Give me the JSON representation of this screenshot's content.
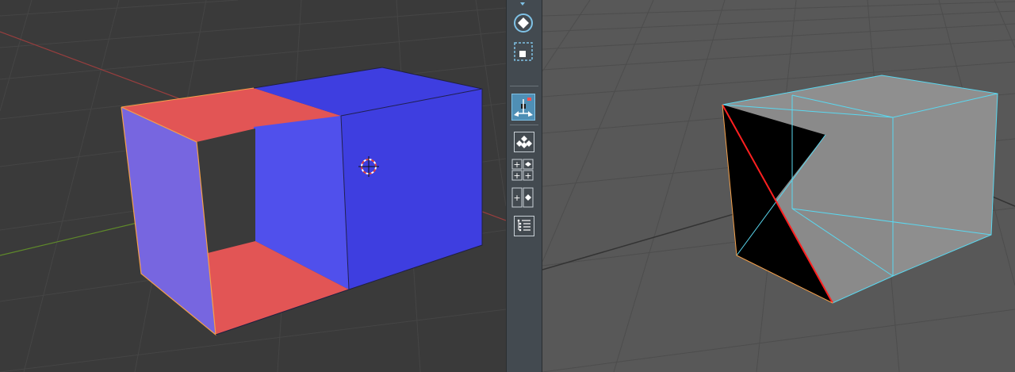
{
  "app": {
    "left_viewport": {
      "name": "3d-viewport-left",
      "object_colors": {
        "front_frame_side": "#7766e0",
        "red_faces": "#e25555",
        "blue_faces": "#3e3ee0",
        "blue_inner": "#5050ec",
        "selected_edge": "#f5a04a"
      },
      "axis_colors": {
        "x": "#c04848",
        "y": "#6d9a2e"
      }
    },
    "toolbar": {
      "tools": [
        {
          "name": "transform-gizmo-tool",
          "icon": "diamond-circle-icon"
        },
        {
          "name": "select-box-tool",
          "icon": "select-box-icon"
        },
        {
          "name": "snap-align-tool",
          "icon": "align-nodes-icon",
          "active": true
        },
        {
          "name": "grid-snap-tool",
          "icon": "grid-diamond-icon"
        },
        {
          "name": "add-remove-grid-tool",
          "icon": "plus-grid-icon"
        },
        {
          "name": "add-point-tool",
          "icon": "plus-point-icon"
        },
        {
          "name": "list-tool",
          "icon": "list-icon"
        }
      ]
    },
    "right_viewport": {
      "name": "3d-viewport-right",
      "colors": {
        "background": "#585858",
        "grid": "#4a4a4a",
        "mesh_face": "#8e8e8e",
        "wire": "#5ad8f0",
        "black_face": "#000000",
        "red_edge": "#ff2020"
      }
    }
  }
}
